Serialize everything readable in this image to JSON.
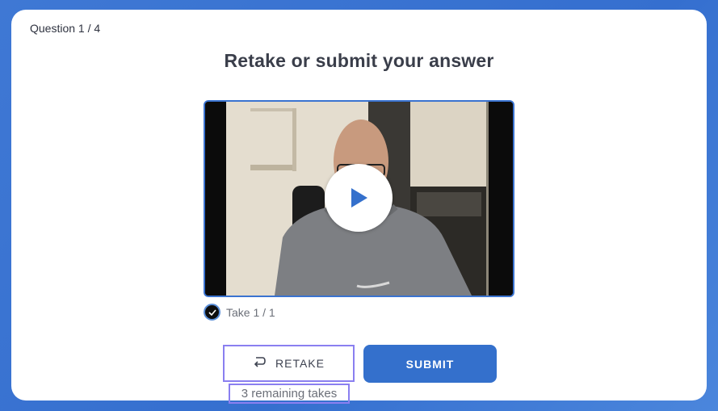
{
  "question_counter": "Question 1 / 4",
  "heading": "Retake or submit your answer",
  "video": {
    "play_icon": "play-icon",
    "accent_color": "#3470cc"
  },
  "take": {
    "label": "Take 1 / 1",
    "selected": true,
    "icon": "check-icon"
  },
  "buttons": {
    "retake_label": "RETAKE",
    "retake_icon": "retake-arrow-icon",
    "submit_label": "SUBMIT"
  },
  "remaining_text": "3 remaining takes",
  "colors": {
    "background": "#3f78d4",
    "primary": "#3470cc",
    "highlight_outline": "#8a7ff0"
  }
}
